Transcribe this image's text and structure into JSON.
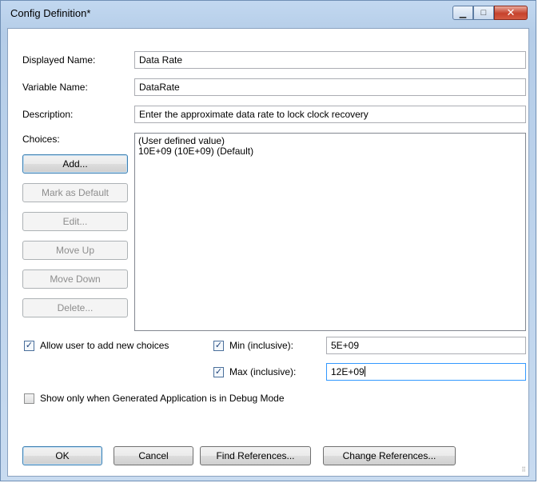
{
  "window": {
    "title": "Config Definition*",
    "minimize_glyph": "▁",
    "maximize_glyph": "□",
    "close_glyph": "✕"
  },
  "form": {
    "displayed_name_label": "Displayed Name:",
    "displayed_name_value": "Data Rate",
    "variable_name_label": "Variable Name:",
    "variable_name_value": "DataRate",
    "description_label": "Description:",
    "description_value": "Enter the approximate data rate to lock clock recovery",
    "choices_label": "Choices:"
  },
  "choice_buttons": {
    "add": "Add...",
    "mark_default": "Mark as Default",
    "edit": "Edit...",
    "move_up": "Move Up",
    "move_down": "Move Down",
    "delete": "Delete..."
  },
  "choices_list": [
    "(User defined value)",
    "10E+09  (10E+09) (Default)"
  ],
  "options": {
    "allow_new_choices_label": "Allow user to add new choices",
    "allow_new_choices_checked": true,
    "min_label": "Min (inclusive):",
    "min_checked": true,
    "min_value": "5E+09",
    "max_label": "Max (inclusive):",
    "max_checked": true,
    "max_value": "12E+09",
    "debug_label": "Show only when Generated Application is in Debug Mode",
    "debug_checked": false
  },
  "footer": {
    "ok": "OK",
    "cancel": "Cancel",
    "find_references": "Find References...",
    "change_references": "Change References..."
  },
  "check_glyph": "✓",
  "grip_glyph": "⠿"
}
